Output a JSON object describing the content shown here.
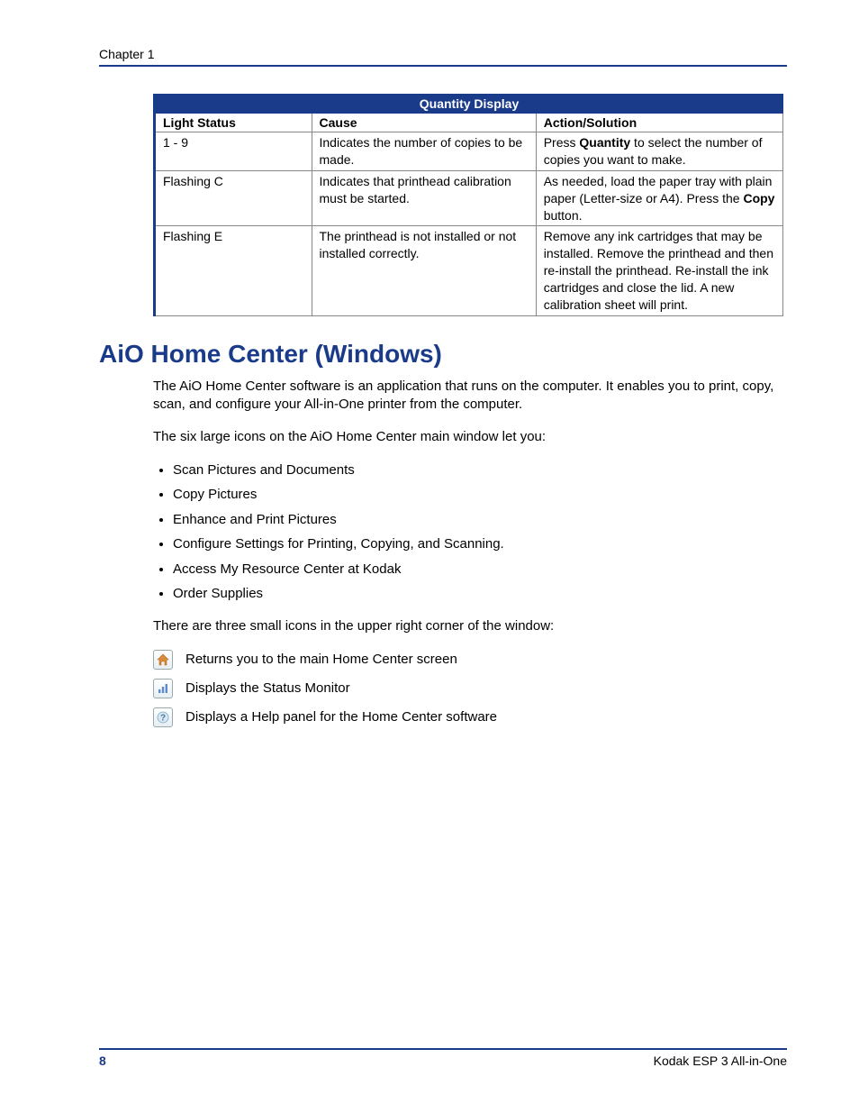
{
  "header": {
    "chapter": "Chapter 1"
  },
  "table": {
    "title": "Quantity Display",
    "headers": {
      "c0": "Light Status",
      "c1": "Cause",
      "c2": "Action/Solution"
    },
    "rows": [
      {
        "c0": "1 - 9",
        "c1": "Indicates the number of copies to be made.",
        "c2_pre": "Press ",
        "c2_b": "Quantity",
        "c2_post": " to select the number of copies you want to make."
      },
      {
        "c0": "Flashing C",
        "c1": "Indicates that printhead calibration must be started.",
        "c2_pre": "As needed, load the paper tray with plain paper (Letter-size or A4). Press the ",
        "c2_b": "Copy",
        "c2_post": " button."
      },
      {
        "c0": "Flashing E",
        "c1": "The printhead is not installed or not installed correctly.",
        "c2_full": "Remove any ink cartridges that may be installed. Remove the printhead and then re-install the printhead. Re-install the ink cartridges and close the lid. A new calibration sheet will print."
      }
    ]
  },
  "section": {
    "heading": "AiO Home Center (Windows)",
    "p1": "The AiO Home Center software is an application that runs on the computer. It enables you to print, copy, scan, and configure your All-in-One printer from the computer.",
    "p2": "The six large icons on the AiO Home Center main window let you:",
    "bullets": [
      "Scan Pictures and Documents",
      "Copy Pictures",
      "Enhance and Print Pictures",
      "Configure Settings for Printing, Copying, and Scanning.",
      "Access My Resource Center at Kodak",
      "Order Supplies"
    ],
    "p3": "There are three small icons in the upper right corner of the window:",
    "icon_items": [
      "Returns you to the main Home Center screen",
      "Displays the Status Monitor",
      "Displays a Help panel for the Home Center software"
    ]
  },
  "footer": {
    "page": "8",
    "product": "Kodak ESP 3 All-in-One"
  }
}
